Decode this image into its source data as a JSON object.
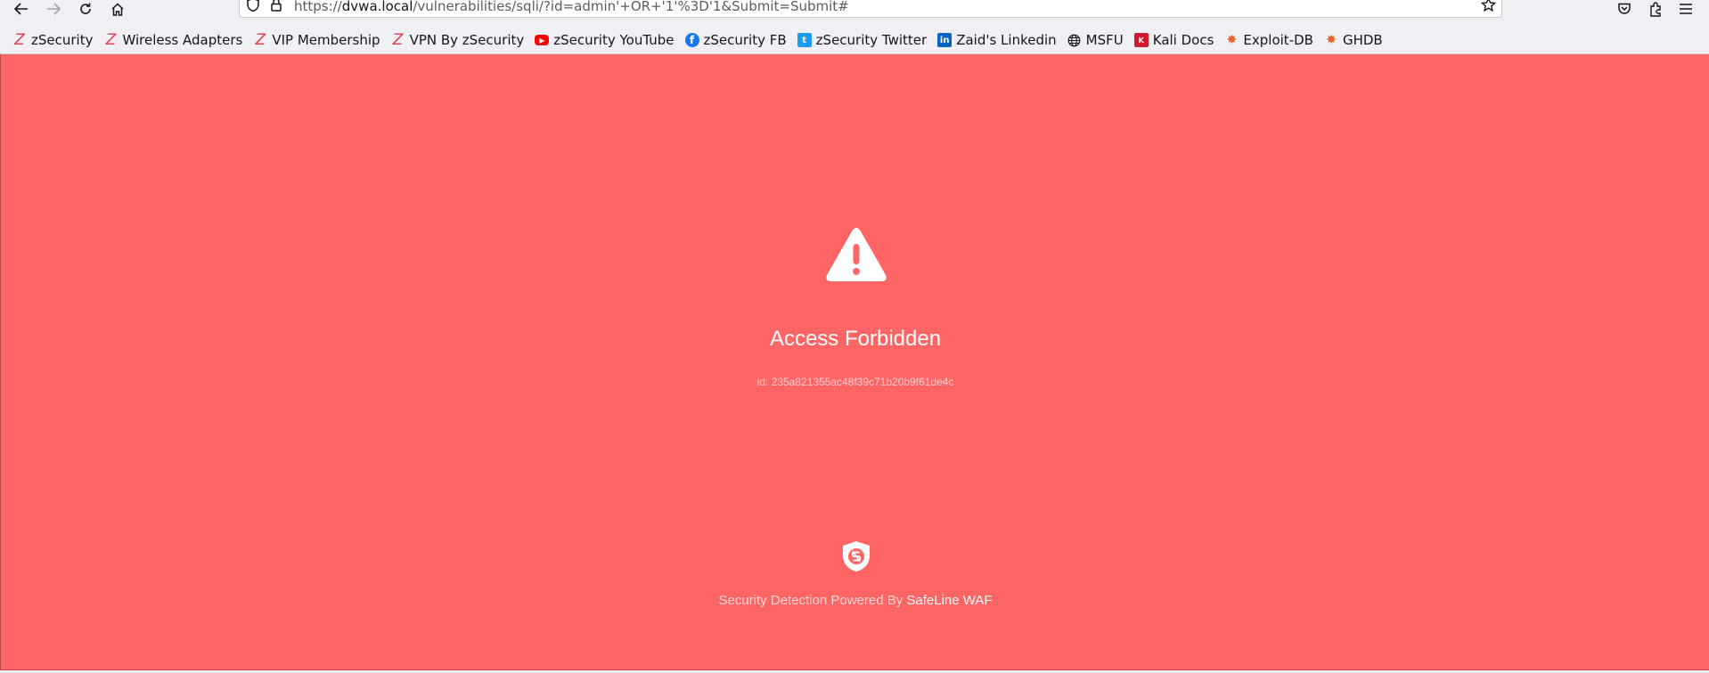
{
  "browser": {
    "url_prefix": "https://",
    "url_host": "dvwa.local",
    "url_path": "/vulnerabilities/sqli/?id=admin'+OR+'1'%3D'1&Submit=Submit#",
    "icons": [
      "back-icon",
      "forward-icon",
      "reload-icon",
      "home-icon",
      "shield-icon",
      "lock-icon",
      "star-icon",
      "pocket-icon",
      "extensions-icon",
      "menu-icon"
    ]
  },
  "bookmarks": [
    {
      "label": "zSecurity",
      "icon": "zsecurity-icon"
    },
    {
      "label": "Wireless Adapters",
      "icon": "zsecurity-icon"
    },
    {
      "label": "VIP Membership",
      "icon": "zsecurity-icon"
    },
    {
      "label": "VPN By zSecurity",
      "icon": "zsecurity-icon"
    },
    {
      "label": "zSecurity YouTube",
      "icon": "youtube-icon"
    },
    {
      "label": "zSecurity FB",
      "icon": "facebook-icon"
    },
    {
      "label": "zSecurity Twitter",
      "icon": "twitter-icon"
    },
    {
      "label": "Zaid's Linkedin",
      "icon": "linkedin-icon"
    },
    {
      "label": "MSFU",
      "icon": "globe-icon"
    },
    {
      "label": "Kali Docs",
      "icon": "kali-icon"
    },
    {
      "label": "Exploit-DB",
      "icon": "exploitdb-icon"
    },
    {
      "label": "GHDB",
      "icon": "exploitdb-icon"
    }
  ],
  "page": {
    "title": "Access Forbidden",
    "request_id": "id: 235a821355ac48f39c71b20b9f61de4c",
    "footer_prefix": "Security Detection Powered By ",
    "footer_brand": "SafeLine WAF",
    "background_color": "#ff6565"
  }
}
